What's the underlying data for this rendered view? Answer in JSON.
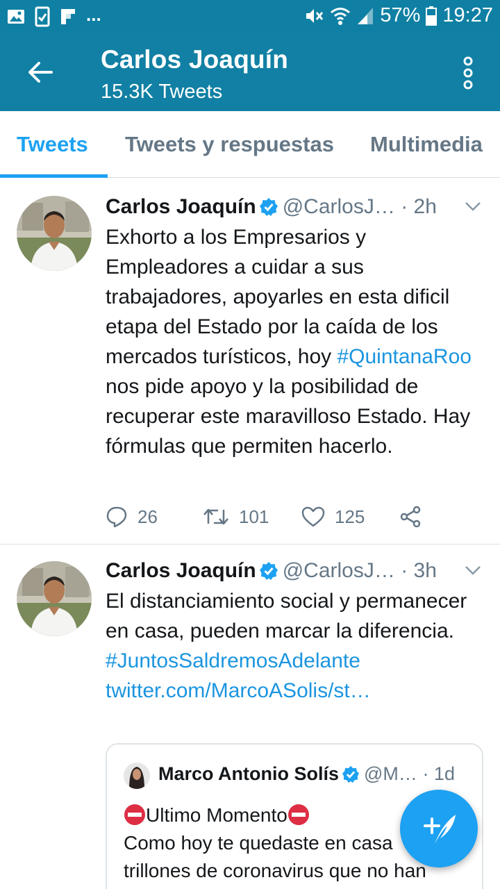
{
  "status_bar": {
    "battery": "57%",
    "time": "19:27",
    "notif_more": "..."
  },
  "header": {
    "name": "Carlos Joaquín",
    "tweet_count": "15.3K Tweets"
  },
  "tabs": [
    {
      "label": "Tweets",
      "active": true
    },
    {
      "label": "Tweets y respuestas",
      "active": false
    },
    {
      "label": "Multimedia",
      "active": false
    }
  ],
  "tweets": [
    {
      "name": "Carlos Joaquín",
      "handle": "@CarlosJ…",
      "time": "· 2h",
      "text_1": "Exhorto a los Empresarios y Empleadores a cuidar a sus trabajadores, apoyarles en esta dificil etapa del Estado por la caída de los mercados turísticos, hoy ",
      "hashtag": "#QuintanaRoo",
      "text_2": " nos pide apoyo y la posibilidad de recuperar este maravilloso Estado. Hay fórmulas que permiten hacerlo.",
      "replies": "26",
      "retweets": "101",
      "likes": "125"
    },
    {
      "name": "Carlos Joaquín",
      "handle": "@CarlosJ…",
      "time": "· 3h",
      "text_1": "El distanciamiento social y permanecer en casa, pueden marcar la diferencia.",
      "hashtag": "#JuntosSaldremosAdelante",
      "link": "twitter.com/MarcoASolis/st…"
    }
  ],
  "quoted": {
    "name": "Marco Antonio Solís",
    "handle": "@M…",
    "time": "· 1d",
    "line_1": "Ultimo Momento",
    "line_2": "Como hoy te quedaste en casa",
    "line_3": "trillones de coronavirus que no han"
  },
  "colors": {
    "header_bg": "#1180a4",
    "accent": "#1da1f2",
    "link": "#1b95e0"
  },
  "icons": [
    "back-arrow-icon",
    "overflow-menu-icon",
    "verified-badge-icon",
    "chevron-down-icon",
    "reply-icon",
    "retweet-icon",
    "like-icon",
    "share-icon",
    "compose-tweet-icon"
  ]
}
